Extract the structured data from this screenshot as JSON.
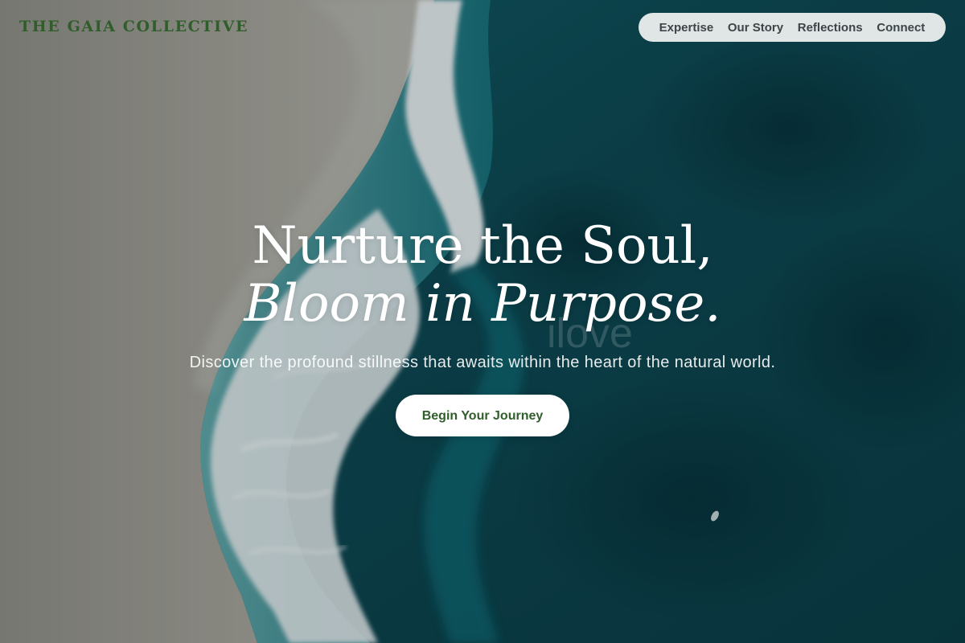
{
  "header": {
    "brand": "THE GAIA COLLECTIVE"
  },
  "nav": {
    "items": [
      {
        "label": "Expertise"
      },
      {
        "label": "Our Story"
      },
      {
        "label": "Reflections"
      },
      {
        "label": "Connect"
      }
    ]
  },
  "hero": {
    "headline_line1": "Nurture the Soul,",
    "headline_line2": "Bloom in Purpose.",
    "ghost_text": "ilove",
    "subtitle": "Discover the profound stillness that awaits within the heart of the natural world.",
    "cta_label": "Begin Your Journey"
  },
  "colors": {
    "brand_green": "#2f5e2a",
    "sand": "#9a9790",
    "ocean_deep": "#0a3f4a",
    "foam": "#e9eef0",
    "nav_pill": "#eef0f0",
    "cta_background": "#ffffff"
  }
}
